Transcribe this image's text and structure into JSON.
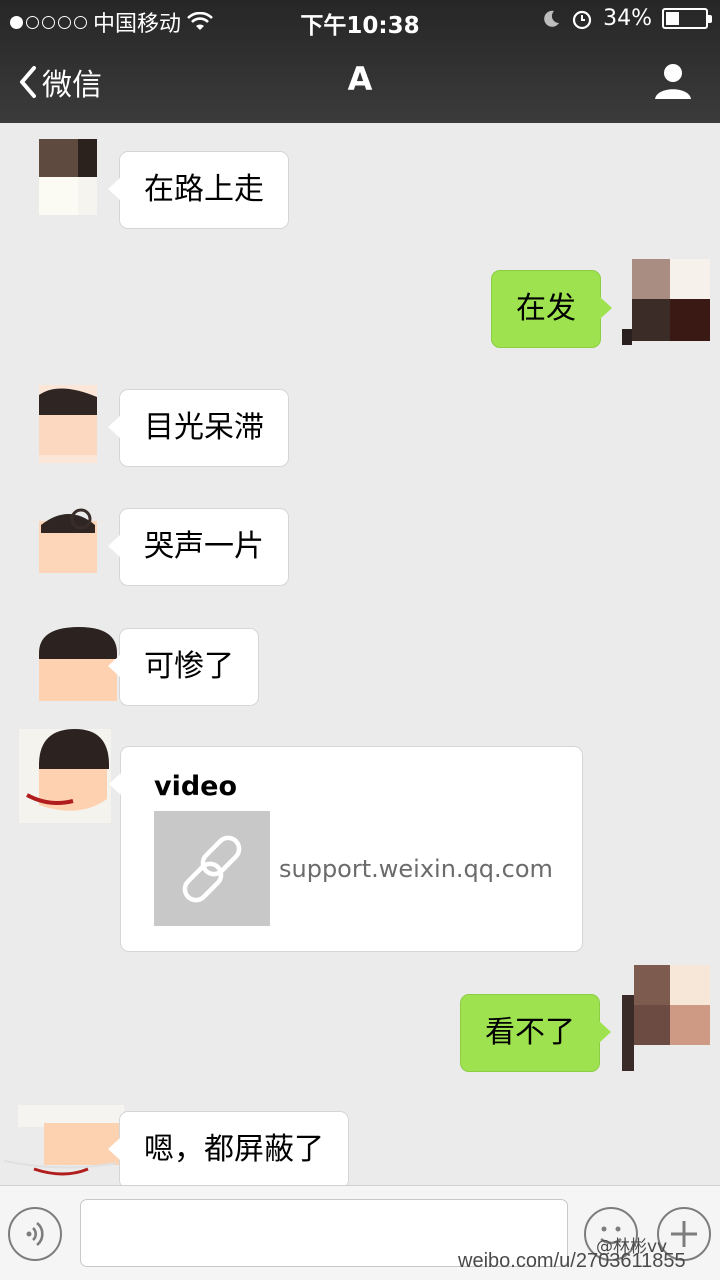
{
  "status_bar": {
    "carrier": "中国移动",
    "time": "下午10:38",
    "battery_pct": "34%",
    "battery_level": 0.34
  },
  "nav": {
    "back_label": "微信",
    "title": "A"
  },
  "messages": [
    {
      "side": "in",
      "text": "在路上走"
    },
    {
      "side": "out",
      "text": "在发"
    },
    {
      "side": "in",
      "text": "目光呆滞"
    },
    {
      "side": "in",
      "text": "哭声一片"
    },
    {
      "side": "in",
      "text": "可惨了"
    },
    {
      "side": "in",
      "type": "link",
      "title": "video",
      "url": "support.weixin.qq.com"
    },
    {
      "side": "out",
      "text": "看不了"
    },
    {
      "side": "in",
      "text": "嗯，都屏蔽了"
    }
  ],
  "watermark": {
    "handle": "@林彬vv",
    "url": "weibo.com/u/2703611855"
  },
  "colors": {
    "nav_bg": "#2e2e2e",
    "chat_bg": "#ebebeb",
    "outgoing_bubble": "#9ee34f",
    "incoming_bubble": "#ffffff"
  }
}
